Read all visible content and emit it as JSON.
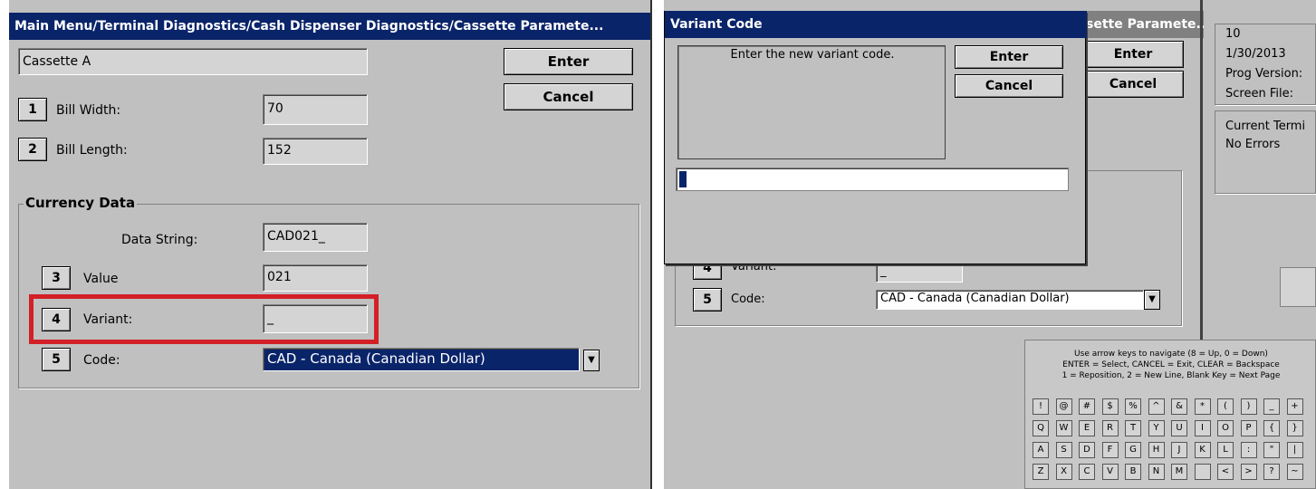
{
  "left": {
    "title": "Main Menu/Terminal Diagnostics/Cash Dispenser Diagnostics/Cassette Paramete...",
    "cassette_name": "Cassette A",
    "enter_label": "Enter",
    "cancel_label": "Cancel",
    "fields": [
      {
        "num": "1",
        "label": "Bill Width:",
        "value": "70"
      },
      {
        "num": "2",
        "label": "Bill Length:",
        "value": "152"
      }
    ],
    "currency": {
      "title": "Currency Data",
      "data_string_label": "Data String:",
      "data_string_value": "CAD021_",
      "value_num": "3",
      "value_label": "Value",
      "value_value": "021",
      "variant_num": "4",
      "variant_label": "Variant:",
      "variant_value": "_",
      "code_num": "5",
      "code_label": "Code:",
      "code_value": "CAD - Canada (Canadian Dollar)"
    },
    "highlight_color": "#d32027"
  },
  "right": {
    "dialog": {
      "title": "Variant Code",
      "prompt": "Enter the new variant code.",
      "enter_label": "Enter",
      "cancel_label": "Cancel",
      "input_value": ""
    },
    "bg_title": "sette Paramete...",
    "bg_enter": "Enter",
    "bg_cancel": "Cancel",
    "bg_variant_num": "4",
    "bg_variant_label": "Variant:",
    "bg_variant_value": "_",
    "bg_code_num": "5",
    "bg_code_label": "Code:",
    "bg_code_value": "CAD - Canada (Canadian Dollar)",
    "status": {
      "line1": "10",
      "line2": "1/30/2013",
      "line3": "Prog Version:",
      "line4": "Screen File:",
      "line5": "Current Termi",
      "line6": "No Errors"
    },
    "keyboard": {
      "help1": "Use arrow keys to navigate (8 = Up, 0 = Down)",
      "help2": "ENTER = Select, CANCEL = Exit, CLEAR = Backspace",
      "help3": "1 = Reposition, 2 = New Line, Blank Key = Next Page",
      "rows": [
        [
          "!",
          "@",
          "#",
          "$",
          "%",
          "^",
          "&",
          "*",
          "(",
          ")",
          "_",
          "+"
        ],
        [
          "Q",
          "W",
          "E",
          "R",
          "T",
          "Y",
          "U",
          "I",
          "O",
          "P",
          "{",
          "}"
        ],
        [
          "A",
          "S",
          "D",
          "F",
          "G",
          "H",
          "J",
          "K",
          "L",
          ":",
          "\"",
          "|"
        ],
        [
          "Z",
          "X",
          "C",
          "V",
          "B",
          "N",
          "M",
          "",
          "<",
          ">",
          "?",
          "~"
        ]
      ]
    }
  }
}
